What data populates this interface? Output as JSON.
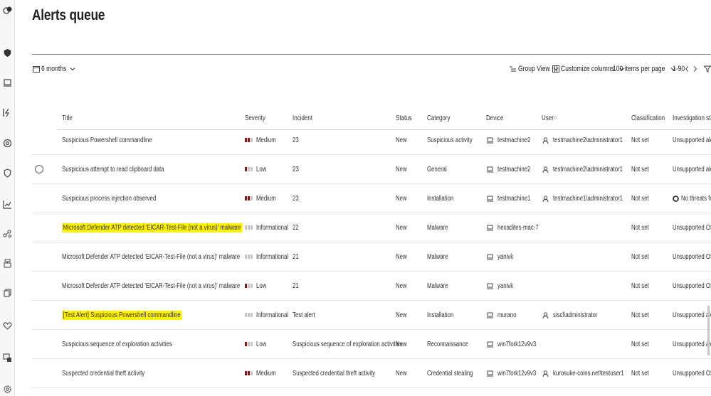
{
  "page": {
    "title": "Alerts queue"
  },
  "toolbar": {
    "date_filter": "6 months",
    "group_view": "Group View",
    "customize_columns": "Customize columns",
    "items_per_page": "100 items per page",
    "pagination": "1-90"
  },
  "nav": [
    "alerts-badge-icon",
    "shield-icon",
    "device-icon",
    "lightning-icon",
    "target-icon",
    "shield-check-icon",
    "chart-icon",
    "graph-icon",
    "lab-icon",
    "copy-icon",
    "heart-icon",
    "devices-icon",
    "settings-icon"
  ],
  "columns": {
    "title": "Title",
    "severity": "Severity",
    "incident": "Incident",
    "status": "Status",
    "category": "Category",
    "device": "Device",
    "user": "User",
    "classification": "Classification",
    "investigation_state": "Investigation state"
  },
  "severity_colors": {
    "filled": "#7a1c1c",
    "empty": "#c8c6c4"
  },
  "highlight_color": "#fff200",
  "rows": [
    {
      "title": "Suspicious Powershell commandline",
      "severity": "Medium",
      "level": 2,
      "incident": "23",
      "status": "New",
      "category": "Suspicious activity",
      "device": "testmachine2",
      "user": "testmachine2\\administrator1",
      "classification": "Not set",
      "investigation": "Unsupported alert ty",
      "highlight": false,
      "radio": false,
      "inv_icon": false
    },
    {
      "title": "Suspicious attempt to read clipboard data",
      "severity": "Low",
      "level": 1,
      "incident": "23",
      "status": "New",
      "category": "General",
      "device": "testmachine2",
      "user": "testmachine2\\administrator1",
      "classification": "Not set",
      "investigation": "Unsupported alert ty",
      "highlight": false,
      "radio": true,
      "inv_icon": false
    },
    {
      "title": "Suspicious process injection observed",
      "severity": "Medium",
      "level": 2,
      "incident": "23",
      "status": "New",
      "category": "Installation",
      "device": "testmachine1",
      "user": "testmachine1\\administrator1",
      "classification": "Not set",
      "investigation": "No threats foun",
      "highlight": false,
      "radio": false,
      "inv_icon": true
    },
    {
      "title": "Microsoft Defender ATP detected 'EICAR-Test-File (not a virus)' malware",
      "severity": "Informational",
      "level": 0,
      "incident": "22",
      "status": "New",
      "category": "Malware",
      "device": "hexadites-mac-7",
      "user": "",
      "classification": "Not set",
      "investigation": "Unsupported OS",
      "highlight": true,
      "radio": false,
      "inv_icon": false
    },
    {
      "title": "Microsoft Defender ATP detected 'EICAR-Test-File (not a virus)' malware",
      "severity": "Informational",
      "level": 0,
      "incident": "21",
      "status": "New",
      "category": "Malware",
      "device": "yanivk",
      "user": "",
      "classification": "Not set",
      "investigation": "Unsupported OS",
      "highlight": false,
      "radio": false,
      "inv_icon": false
    },
    {
      "title": "Microsoft Defender ATP detected 'EICAR-Test-File (not a virus)' malware",
      "severity": "Low",
      "level": 1,
      "incident": "21",
      "status": "New",
      "category": "Malware",
      "device": "yanivk",
      "user": "",
      "classification": "Not set",
      "investigation": "Unsupported OS",
      "highlight": false,
      "radio": false,
      "inv_icon": false
    },
    {
      "title": "[Test Alert] Suspicious Powershell commandline",
      "severity": "Informational",
      "level": 0,
      "incident": "Test alert",
      "status": "New",
      "category": "Installation",
      "device": "murano",
      "user": "siscl\\administrator",
      "classification": "Not set",
      "investigation": "Unsupported alert ty",
      "highlight": true,
      "radio": false,
      "inv_icon": false
    },
    {
      "title": "Suspicious sequence of exploration activities",
      "severity": "Low",
      "level": 1,
      "incident": "Suspicious sequence of exploration activities",
      "status": "New",
      "category": "Reconnaissance",
      "device": "win7fork12v9v3",
      "user": "",
      "classification": "Not set",
      "investigation": "Unsupported alert ty",
      "highlight": false,
      "radio": false,
      "inv_icon": false
    },
    {
      "title": "Suspected credential theft activity",
      "severity": "Medium",
      "level": 2,
      "incident": "Suspected credential theft activity",
      "status": "New",
      "category": "Credential stealing",
      "device": "win7fork12v9v3",
      "user": "kurosuke-coins.net\\testuser1",
      "classification": "Not set",
      "investigation": "Unsupported OS",
      "highlight": false,
      "radio": false,
      "inv_icon": false
    }
  ]
}
